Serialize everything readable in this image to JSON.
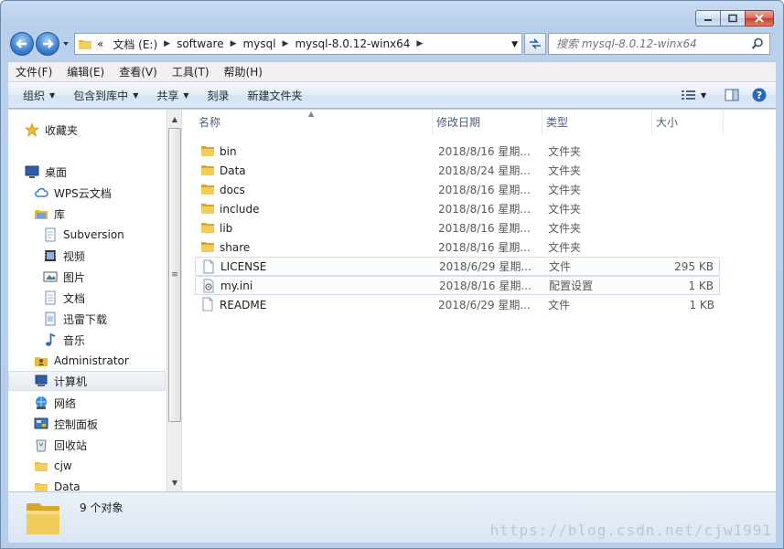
{
  "address": {
    "overflow": "«",
    "crumbs": [
      "文档 (E:)",
      "software",
      "mysql",
      "mysql-8.0.12-winx64"
    ]
  },
  "search": {
    "placeholder": "搜索 mysql-8.0.12-winx64"
  },
  "menu": [
    "文件(F)",
    "编辑(E)",
    "查看(V)",
    "工具(T)",
    "帮助(H)"
  ],
  "toolbar": {
    "organize": "组织",
    "include_in_library": "包含到库中",
    "share": "共享",
    "burn": "刻录",
    "new_folder": "新建文件夹"
  },
  "navpane": {
    "favorites": "收藏夹",
    "desktop": "桌面",
    "wps": "WPS云文档",
    "libraries": "库",
    "subversion": "Subversion",
    "videos": "视频",
    "pictures": "图片",
    "documents": "文档",
    "thunder": "迅雷下载",
    "music": "音乐",
    "administrator": "Administrator",
    "computer": "计算机",
    "network": "网络",
    "control_panel": "控制面板",
    "recycle_bin": "回收站",
    "cjw": "cjw",
    "data": "Data"
  },
  "columns": {
    "name": "名称",
    "date": "修改日期",
    "type": "类型",
    "size": "大小"
  },
  "files": [
    {
      "name": "bin",
      "date": "2018/8/16 星期...",
      "type": "文件夹",
      "size": "",
      "kind": "folder"
    },
    {
      "name": "Data",
      "date": "2018/8/24 星期...",
      "type": "文件夹",
      "size": "",
      "kind": "folder"
    },
    {
      "name": "docs",
      "date": "2018/8/16 星期...",
      "type": "文件夹",
      "size": "",
      "kind": "folder"
    },
    {
      "name": "include",
      "date": "2018/8/16 星期...",
      "type": "文件夹",
      "size": "",
      "kind": "folder"
    },
    {
      "name": "lib",
      "date": "2018/8/16 星期...",
      "type": "文件夹",
      "size": "",
      "kind": "folder"
    },
    {
      "name": "share",
      "date": "2018/8/16 星期...",
      "type": "文件夹",
      "size": "",
      "kind": "folder"
    },
    {
      "name": "LICENSE",
      "date": "2018/6/29 星期...",
      "type": "文件",
      "size": "295 KB",
      "kind": "file"
    },
    {
      "name": "my.ini",
      "date": "2018/8/16 星期...",
      "type": "配置设置",
      "size": "1 KB",
      "kind": "ini"
    },
    {
      "name": "README",
      "date": "2018/6/29 星期...",
      "type": "文件",
      "size": "1 KB",
      "kind": "file"
    }
  ],
  "status": {
    "count": "9 个对象"
  },
  "watermark": "https://blog.csdn.net/cjw1991",
  "colors": {
    "folder": "#e8b93a",
    "accent": "#3b7fd0"
  }
}
